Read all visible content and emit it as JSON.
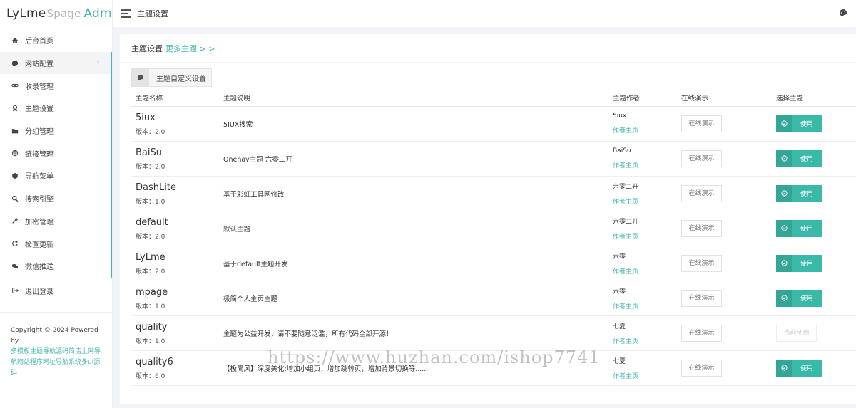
{
  "logo": {
    "part1": "LyLme",
    "part2": "Spage",
    "part3": "Admin"
  },
  "topbar": {
    "title": "主题设置"
  },
  "sidebar": {
    "items": [
      {
        "label": "后台首页",
        "icon": "home-icon"
      },
      {
        "label": "网站配置",
        "icon": "palette-icon",
        "arrow": "›"
      },
      {
        "label": "收录管理",
        "icon": "link-icon"
      },
      {
        "label": "主题设置",
        "icon": "theme-icon"
      },
      {
        "label": "分组管理",
        "icon": "folder-icon"
      },
      {
        "label": "链接管理",
        "icon": "globe-icon"
      },
      {
        "label": "导航菜单",
        "icon": "cube-icon"
      },
      {
        "label": "搜索引擎",
        "icon": "search-icon"
      },
      {
        "label": "加密管理",
        "icon": "wrench-icon"
      },
      {
        "label": "检查更新",
        "icon": "refresh-icon"
      },
      {
        "label": "微信推送",
        "icon": "wechat-icon"
      },
      {
        "label": "退出登录",
        "icon": "logout-icon"
      }
    ],
    "copyright_line": "Copyright © 2024 Powered by",
    "copyright_link": "多模板主题导航源码简洁上网导航网站程序网址导航系统多ui源码"
  },
  "card": {
    "title": "主题设置",
    "more": "更多主题 > >",
    "custom_button": "主题自定义设置"
  },
  "table": {
    "headers": [
      "主题名称",
      "主题说明",
      "主题作者",
      "在线演示",
      "选择主题"
    ],
    "version_prefix": "版本：",
    "author_link": "作者主页",
    "demo_label": "在线演示",
    "use_label": "使用",
    "current_label": "当前使用",
    "rows": [
      {
        "name": "5iux",
        "version": "2.0",
        "desc": "5IUX搜索",
        "author": "5iux",
        "current": false
      },
      {
        "name": "BaiSu",
        "version": "2.0",
        "desc": "Onenav主题 六零二开",
        "author": "BaiSu",
        "current": false
      },
      {
        "name": "DashLite",
        "version": "1.0",
        "desc": "基于彩虹工具网修改",
        "author": "六零二开",
        "current": false
      },
      {
        "name": "default",
        "version": "2.0",
        "desc": "默认主题",
        "author": "六零二开",
        "current": false
      },
      {
        "name": "LyLme",
        "version": "2.0",
        "desc": "基于default主题开发",
        "author": "六零",
        "current": false
      },
      {
        "name": "mpage",
        "version": "1.0",
        "desc": "极简个人主页主题",
        "author": "六零",
        "current": false
      },
      {
        "name": "quality",
        "version": "1.0",
        "desc": "主题为公益开发，请不要随意泛滥，所有代码全部开源！",
        "author": "七夏",
        "current": true
      },
      {
        "name": "quality6",
        "version": "6.0",
        "desc": "【极简风】深度美化:增加小组页，增加跳转页，增加背景切换等......",
        "author": "七夏",
        "current": false
      }
    ]
  },
  "watermark": "https://www.huzhan.com/ishop7741",
  "colors": {
    "accent": "#45b5ae",
    "use_button": "#3bb9a8"
  }
}
